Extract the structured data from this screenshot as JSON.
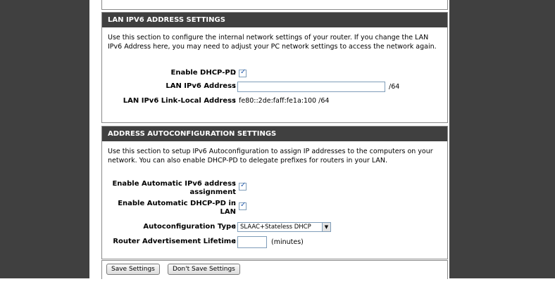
{
  "lan_ipv6": {
    "title": "LAN IPV6 ADDRESS SETTINGS",
    "description": "Use this section to configure the internal network settings of your router. If you change the LAN IPv6 Address here, you may need to adjust your PC network settings to access the network again.",
    "enable_dhcp_pd_label": "Enable DHCP-PD",
    "enable_dhcp_pd_checked": true,
    "lan_ipv6_address_label": "LAN IPv6 Address",
    "lan_ipv6_address_value": "",
    "prefix_suffix": "/64",
    "link_local_label": "LAN IPv6 Link-Local Address",
    "link_local_value": "fe80::2de:faff:fe1a:100 /64"
  },
  "autoconfig": {
    "title": "ADDRESS AUTOCONFIGURATION SETTINGS",
    "description": "Use this section to setup IPv6 Autoconfiguration to assign IP addresses to the computers on your network. You can also enable DHCP-PD to delegate prefixes for routers in your LAN.",
    "auto_ipv6_label_1": "Enable Automatic IPv6 address",
    "auto_ipv6_label_2": "assignment",
    "auto_ipv6_checked": true,
    "auto_dhcp_pd_label_1": "Enable Automatic DHCP-PD in",
    "auto_dhcp_pd_label_2": "LAN",
    "auto_dhcp_pd_checked": true,
    "type_label": "Autoconfiguration Type",
    "type_value": "SLAAC+Stateless DHCP",
    "lifetime_label": "Router Advertisement Lifetime",
    "lifetime_value": "",
    "lifetime_unit": "(minutes)",
    "colon": ":"
  },
  "buttons": {
    "save": "Save Settings",
    "dont_save": "Don't Save Settings"
  }
}
